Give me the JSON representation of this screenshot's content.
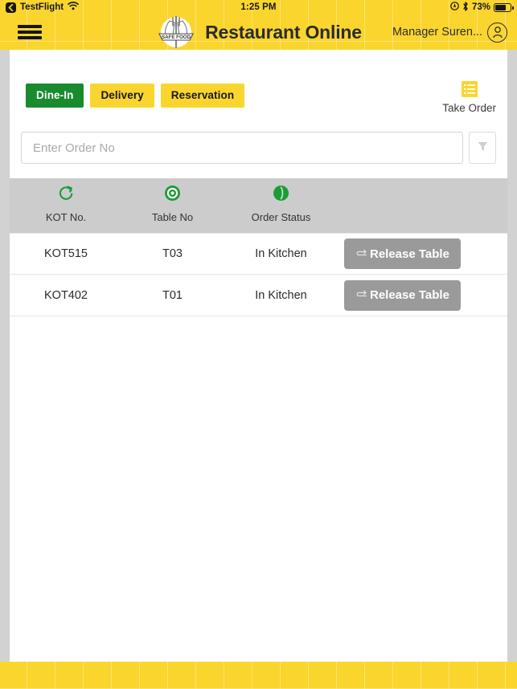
{
  "statusbar": {
    "back_label": "TestFlight",
    "back_icon": "chevron-left-icon",
    "wifi_icon": "wifi-icon",
    "time": "1:25 PM",
    "location_icon": "location-icon",
    "bluetooth_icon": "bluetooth-icon",
    "battery_percent": "73%",
    "battery_icon": "battery-icon"
  },
  "header": {
    "menu_icon": "hamburger-menu-icon",
    "logo_icon": "safe-food-badge-logo",
    "logo_text": "SAFE FOOD",
    "title": "Restaurant Online",
    "user_name": "Manager Suren...",
    "avatar_icon": "user-avatar-icon"
  },
  "tabs": [
    {
      "label": "Dine-In",
      "active": true
    },
    {
      "label": "Delivery",
      "active": false
    },
    {
      "label": "Reservation",
      "active": false
    }
  ],
  "take_order": {
    "label": "Take Order",
    "icon": "list-icon"
  },
  "search": {
    "value": "",
    "placeholder": "Enter Order No",
    "filter_icon": "filter-funnel-icon"
  },
  "table": {
    "columns": [
      {
        "label": "KOT No.",
        "icon": "refresh-circle-icon"
      },
      {
        "label": "Table No",
        "icon": "target-circle-icon"
      },
      {
        "label": "Order Status",
        "icon": "status-circle-icon"
      }
    ],
    "action_button_label": "Release Table",
    "action_button_icon": "undo-arrow-icon",
    "rows": [
      {
        "kot_no": "KOT515",
        "table_no": "T03",
        "order_status": "In Kitchen",
        "action": "Release Table"
      },
      {
        "kot_no": "KOT402",
        "table_no": "T01",
        "order_status": "In Kitchen",
        "action": "Release Table"
      }
    ]
  },
  "colors": {
    "brand_yellow": "#fad52e",
    "accent_green": "#1a8a2e",
    "button_gray": "#9a9a9a",
    "header_band": "#cccccc",
    "page_gray": "#d2d2d2"
  }
}
